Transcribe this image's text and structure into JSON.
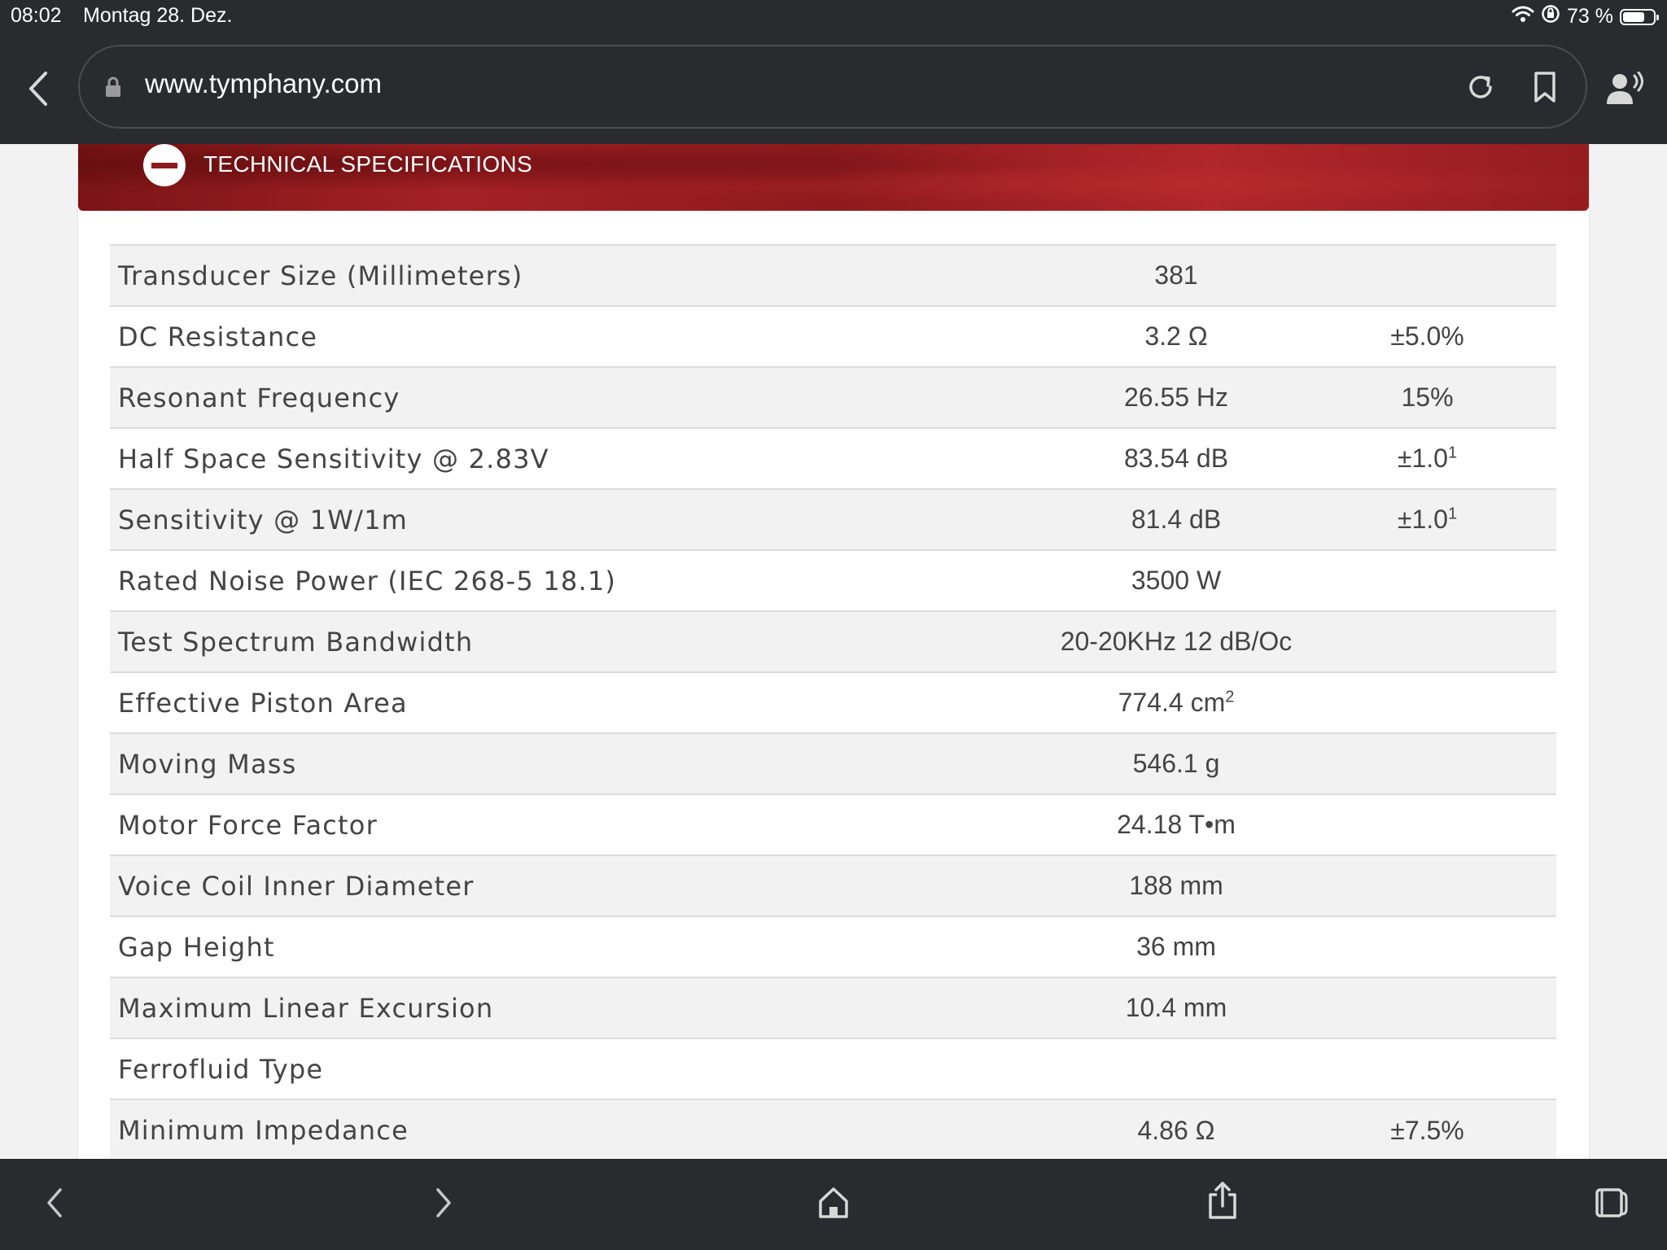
{
  "status_bar": {
    "time": "08:02",
    "date": "Montag 28. Dez.",
    "battery": "73 %",
    "battery_level": 0.73
  },
  "browser": {
    "url": "www.tymphany.com",
    "icons": [
      "back-icon",
      "lock-icon",
      "reload-icon",
      "bookmark-icon",
      "reader-voice-icon"
    ]
  },
  "section": {
    "title": "TECHNICAL SPECIFICATIONS",
    "toggle_icon": "minus-circle-icon",
    "accent": "#a01e22"
  },
  "specs": [
    {
      "label": "Transducer Size (Millimeters)",
      "value": "381",
      "tolerance": ""
    },
    {
      "label": "DC Resistance",
      "value": "3.2 Ω",
      "tolerance": "±5.0%"
    },
    {
      "label": "Resonant Frequency",
      "value": "26.55 Hz",
      "tolerance": "15%"
    },
    {
      "label": "Half Space Sensitivity @ 2.83V",
      "value": "83.54 dB",
      "tolerance": "±1.0",
      "tolerance_sup": "1"
    },
    {
      "label": "Sensitivity @ 1W/1m",
      "value": "81.4 dB",
      "tolerance": "±1.0",
      "tolerance_sup": "1"
    },
    {
      "label": "Rated Noise Power (IEC 268-5 18.1)",
      "value": "3500 W",
      "tolerance": ""
    },
    {
      "label": "Test Spectrum Bandwidth",
      "value": "20-20KHz 12 dB/Oc",
      "tolerance": ""
    },
    {
      "label": "Effective Piston Area",
      "value": "774.4 cm",
      "value_sup": "2",
      "tolerance": ""
    },
    {
      "label": "Moving Mass",
      "value": "546.1 g",
      "tolerance": ""
    },
    {
      "label": "Motor Force Factor",
      "value": "24.18 T•m",
      "tolerance": ""
    },
    {
      "label": "Voice Coil Inner Diameter",
      "value": "188 mm",
      "tolerance": ""
    },
    {
      "label": "Gap Height",
      "value": "36 mm",
      "tolerance": ""
    },
    {
      "label": "Maximum Linear Excursion",
      "value": "10.4 mm",
      "tolerance": ""
    },
    {
      "label": "Ferrofluid Type",
      "value": "",
      "tolerance": ""
    },
    {
      "label": "Minimum Impedance",
      "value": "4.86 Ω",
      "tolerance": "±7.5%"
    }
  ],
  "toolbar": {
    "icons": [
      "back-arrow-icon",
      "forward-arrow-icon",
      "home-icon",
      "share-icon",
      "tabs-icon"
    ]
  }
}
